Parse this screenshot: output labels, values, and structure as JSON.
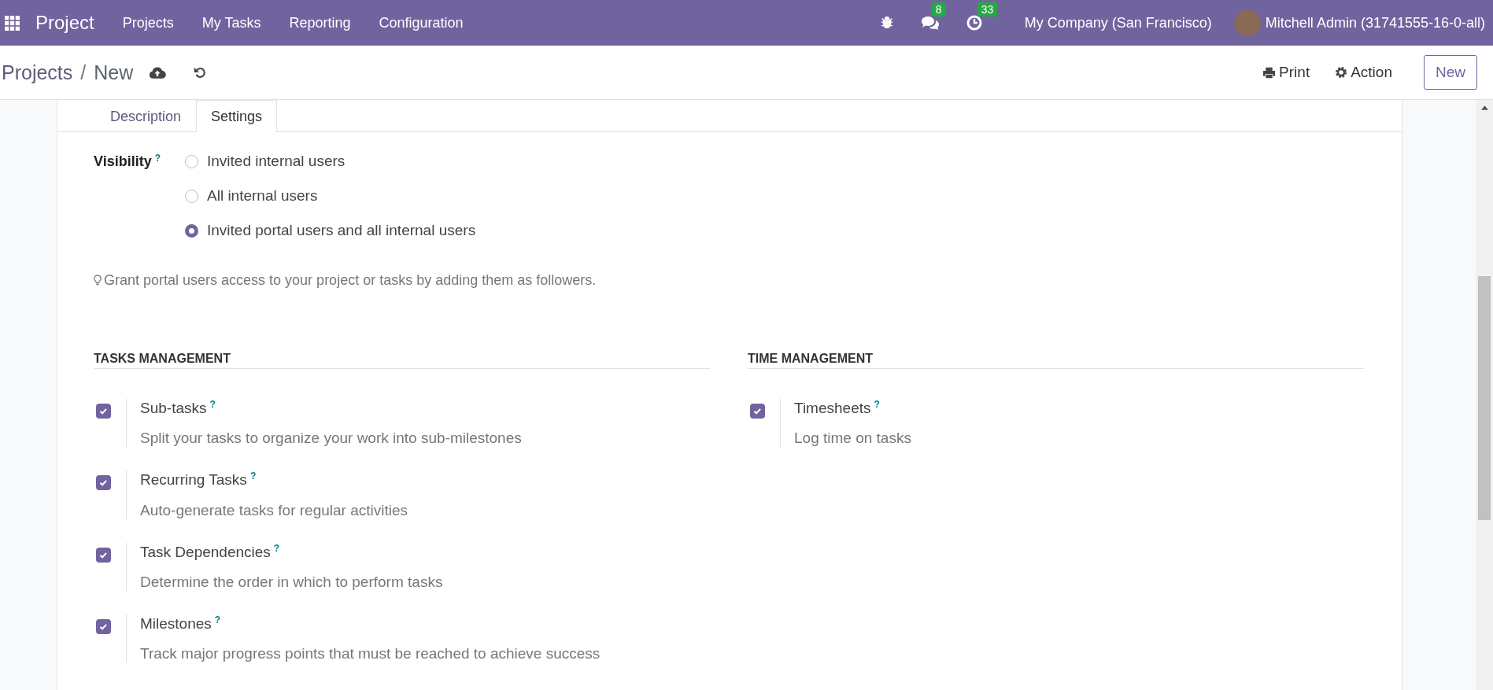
{
  "navbar": {
    "app_name": "Project",
    "menu": [
      "Projects",
      "My Tasks",
      "Reporting",
      "Configuration"
    ],
    "messages_count": "8",
    "activities_count": "33",
    "company": "My Company (San Francisco)",
    "user": "Mitchell Admin (31741555-16-0-all)"
  },
  "breadcrumb": {
    "parent": "Projects",
    "separator": "/",
    "current": "New"
  },
  "actions": {
    "print": "Print",
    "action": "Action",
    "new": "New"
  },
  "tabs": [
    {
      "label": "Description",
      "selected": false
    },
    {
      "label": "Settings",
      "selected": true
    }
  ],
  "visibility": {
    "label": "Visibility",
    "help": "?",
    "options": [
      {
        "label": "Invited internal users",
        "selected": false
      },
      {
        "label": "All internal users",
        "selected": false
      },
      {
        "label": "Invited portal users and all internal users",
        "selected": true
      }
    ],
    "hint": "Grant portal users access to your project or tasks by adding them as followers."
  },
  "sections": [
    {
      "title": "TASKS MANAGEMENT",
      "settings": [
        {
          "label": "Sub-tasks",
          "help": "?",
          "description": "Split your tasks to organize your work into sub-milestones",
          "checked": true
        },
        {
          "label": "Recurring Tasks",
          "help": "?",
          "description": "Auto-generate tasks for regular activities",
          "checked": true
        },
        {
          "label": "Task Dependencies",
          "help": "?",
          "description": "Determine the order in which to perform tasks",
          "checked": true
        },
        {
          "label": "Milestones",
          "help": "?",
          "description": "Track major progress points that must be reached to achieve success",
          "checked": true
        }
      ]
    },
    {
      "title": "TIME MANAGEMENT",
      "settings": [
        {
          "label": "Timesheets",
          "help": "?",
          "description": "Log time on tasks",
          "checked": true
        }
      ]
    }
  ]
}
